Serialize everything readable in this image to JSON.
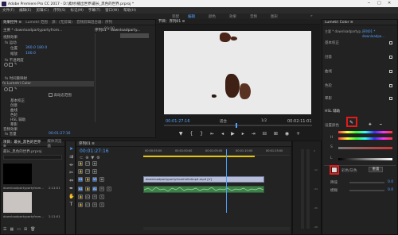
{
  "titlebar": {
    "title": "Adobe Premiere Pro CC 2017 - D:\\素材\\播出世界\\最长_黑色的世界.prproj *"
  },
  "menu": [
    "文件(F)",
    "编辑(E)",
    "剪辑(C)",
    "序列(S)",
    "标记(M)",
    "字幕(T)",
    "窗口(W)",
    "帮助(H)"
  ],
  "workspace": [
    "装配",
    "编辑",
    "颜色",
    "效果",
    "音频",
    "图形"
  ],
  "effect_controls": {
    "tabs": [
      "效果控件 ≡",
      "Lumetri 范围",
      "源：(无剪辑)",
      "音频剪辑混合器：序列"
    ],
    "clip_name": "主要 * downloadpartypartyfrom...",
    "seq_name": "序列01 * downloadparty...",
    "timecode_head": "00:00",
    "rows": [
      {
        "label": "视频效果",
        "value": ""
      },
      {
        "label": "fx 运动",
        "value": ""
      },
      {
        "label": "位置",
        "value": "360.0   180.0"
      },
      {
        "label": "缩放",
        "value": "100.0"
      },
      {
        "label": "fx 不透明度",
        "value": ""
      },
      {
        "label": "fx 时间重映射",
        "value": ""
      },
      {
        "label": "fx Lumetri Color",
        "value": ""
      },
      {
        "label": "高动态范围",
        "value": ""
      },
      {
        "label": "基本校正",
        "value": ""
      },
      {
        "label": "创意",
        "value": ""
      },
      {
        "label": "曲线",
        "value": ""
      },
      {
        "label": "色轮",
        "value": ""
      },
      {
        "label": "HSL 辅助",
        "value": ""
      },
      {
        "label": "晕影",
        "value": ""
      },
      {
        "label": "音频效果",
        "value": ""
      },
      {
        "label": "fx 音量",
        "value": ""
      },
      {
        "label": "声道音量",
        "value": ""
      },
      {
        "label": "fx 声像器",
        "value": ""
      }
    ],
    "bottom_timecode": "00:01:27:16"
  },
  "monitor": {
    "tab": "节目：序列01 ≡",
    "timecode": "00:01:27:16",
    "fit": "适合",
    "fraction": "1/2",
    "duration": "00:02:11:01"
  },
  "lumetri": {
    "tab": "Lumetri Color ≡",
    "clip": "主要 * downloadpartyp...",
    "seq": "序列01 * downloadpa...",
    "sections": [
      "基本校正",
      "创意",
      "曲线",
      "色轮",
      "HSL 辅助",
      "晕影"
    ],
    "hsl": {
      "title": "HSL 辅助",
      "key_label": "设置颜色",
      "h": "H",
      "s": "S",
      "l": "L",
      "refine_label": "彩色/灰色",
      "reset": "重置",
      "denoise": "降噪",
      "denoise_val": "0.0",
      "blur": "模糊",
      "blur_val": "0.0"
    }
  },
  "project": {
    "tabs": [
      "项目：最长_黑色的世界 ≡",
      "媒体浏览器"
    ],
    "file": "最长_黑色的世界.prproj",
    "items": [
      {
        "name": "downloadpartypartyfrom...",
        "dur": "2:11:01"
      },
      {
        "name": "downloadpartypartyfrom...",
        "dur": "2:11:01"
      }
    ]
  },
  "timeline": {
    "tab": "序列01 ≡",
    "timecode": "00:01:27:16",
    "ruler": [
      "00:00:55:00",
      "00:01:00:00",
      "00:01:05:00",
      "00:01:10:00",
      "00:01:15:00"
    ],
    "video_clip": "downloadpartypartyfromfullhdmp4.mp4 [V]",
    "tracks": [
      "V3",
      "V2",
      "V1",
      "A1",
      "A2",
      "A3"
    ]
  },
  "colors": {
    "accent": "#4fa0ff",
    "highlight": "#e31b1b",
    "playhead": "#4fa0ff"
  }
}
